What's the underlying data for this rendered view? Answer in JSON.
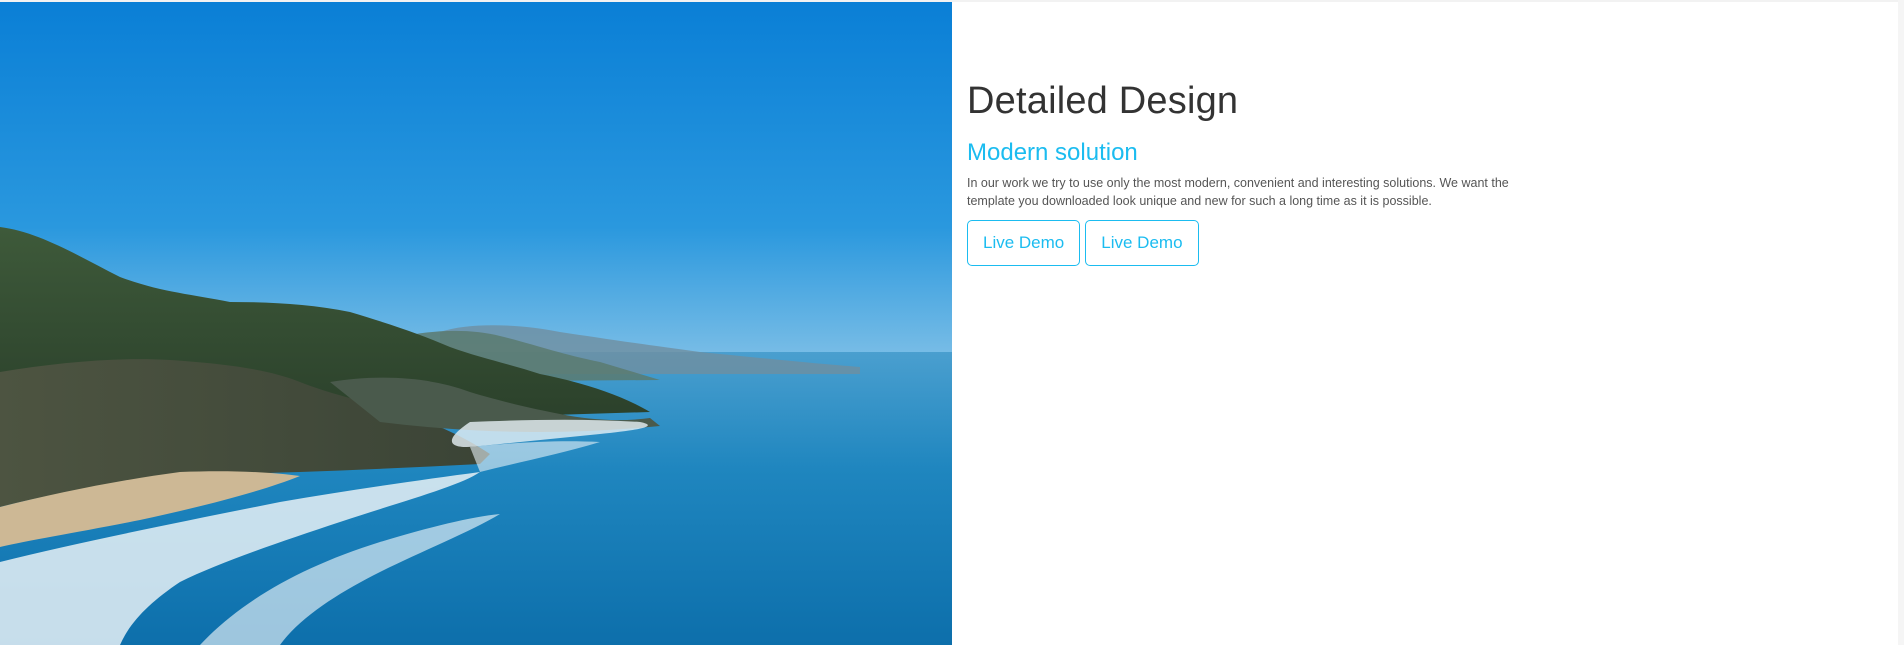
{
  "hero": {
    "image_description": "coastal cliffs and blue ocean",
    "sky_color": "#0a86dc",
    "ocean_color": "#1f86bf"
  },
  "content": {
    "title": "Detailed Design",
    "subtitle": "Modern solution",
    "description": "In our work we try to use only the most modern, convenient and interesting solutions. We want the template you downloaded look unique and new for such a long time as it is possible.",
    "buttons": [
      {
        "label": "Live Demo"
      },
      {
        "label": "Live Demo"
      }
    ]
  },
  "colors": {
    "accent": "#1bbcf0",
    "title_text": "#333333",
    "body_text": "#555555"
  }
}
